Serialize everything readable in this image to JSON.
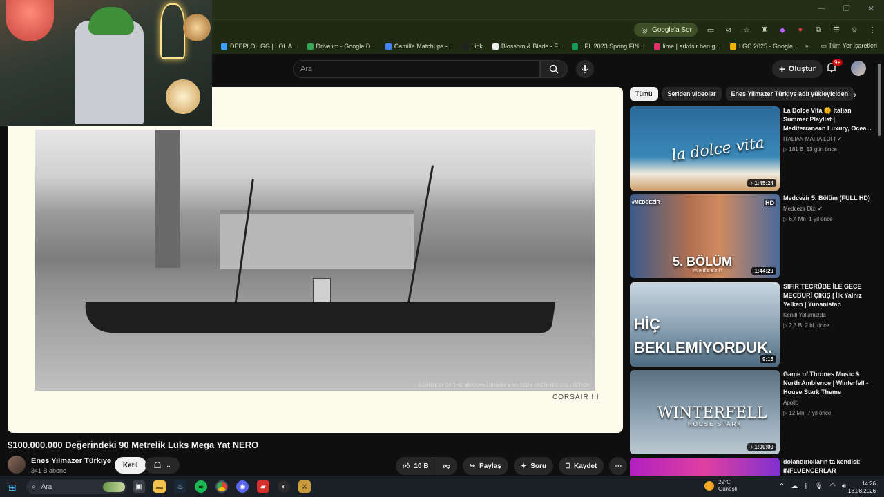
{
  "browser": {
    "google_sor": "Google'a Sor",
    "bookmarks": [
      {
        "label": "DEEPLOL.GG | LOL A...",
        "color": "#3aa0ff"
      },
      {
        "label": "Drive'ım - Google D...",
        "color": "#34a853"
      },
      {
        "label": "Camille Matchups -...",
        "color": "#4285f4"
      },
      {
        "label": "Link",
        "color": "#222222"
      },
      {
        "label": "Blossom & Blade - F...",
        "color": "#eeeeee"
      },
      {
        "label": "LPL 2023 Spring FIN...",
        "color": "#0f9d58"
      },
      {
        "label": "lime | arkdslr ben g...",
        "color": "#e1306c"
      },
      {
        "label": "LGC 2025 - Google...",
        "color": "#f4b400"
      }
    ],
    "all_bookmarks": "Tüm Yer İşaretleri"
  },
  "header": {
    "search_placeholder": "Ara",
    "create_label": "Oluştur",
    "notification_count": "9+"
  },
  "video": {
    "photo_credit": "COURTESY OF THE MORGAN LIBRARY & MUSEUM ARCHIVES COLLECTION",
    "caption": "CORSAIR III",
    "title": "$100.000.000 Değerindeki 90 Metrelik Lüks Mega Yat NERO",
    "channel": "Enes Yilmazer Türkiye",
    "subscribers": "341 B abone",
    "join_label": "Katıl",
    "likes": "10 B",
    "share_label": "Paylaş",
    "ask_label": "Soru",
    "save_label": "Kaydet"
  },
  "chips": [
    "Tümü",
    "Seriden videolar",
    "Enes Yilmazer Türkiye adlı yükleyiciden"
  ],
  "recommendations": [
    {
      "title": "La Dolce Vita 🌞 Italian Summer Playlist | Mediterranean Luxury, Ocea...",
      "channel": "ITALIAN MAFIA LOFI",
      "views": "181 B",
      "age": "13 gün önce",
      "duration": "1:45:24",
      "thumb_text": "la dolce vita"
    },
    {
      "title": "Medcezir 5. Bölüm (FULL HD)",
      "channel": "Medcezir Dizi",
      "views": "6,4 Mn",
      "age": "1 yıl önce",
      "duration": "1:44:29",
      "thumb_text": "5. BÖLÜM",
      "tag": "#MEDCEZİR",
      "hd": "HD",
      "thumb_sub": "medcezir"
    },
    {
      "title": "SIFIR TECRÜBE İLE GECE MECBURİ ÇIKIŞ | İlk Yalnız Yelken | Yunanistan",
      "channel": "Kendi Yolumuzda",
      "views": "2,3 B",
      "age": "2 hf. önce",
      "duration": "9:15",
      "thumb_text": "HİÇ BEKLEMİYORDUK."
    },
    {
      "title": "Game of Thrones Music & North Ambience | Winterfell - House Stark Theme",
      "channel": "Apollo",
      "views": "12 Mn",
      "age": "7 yıl önce",
      "duration": "1:00:00",
      "thumb_text": "WINTERFELL",
      "thumb_sub": "HOUSE STARK"
    },
    {
      "title": "dolandırıcıların ta kendisi: INFLUENCERLAR",
      "channel": "",
      "views": "",
      "age": "",
      "duration": "",
      "thumb_text": ""
    }
  ],
  "taskbar": {
    "search": "Ara",
    "temp": "29°C",
    "weather": "Güneşli",
    "time": "14:26",
    "date": "18.08.2026"
  }
}
